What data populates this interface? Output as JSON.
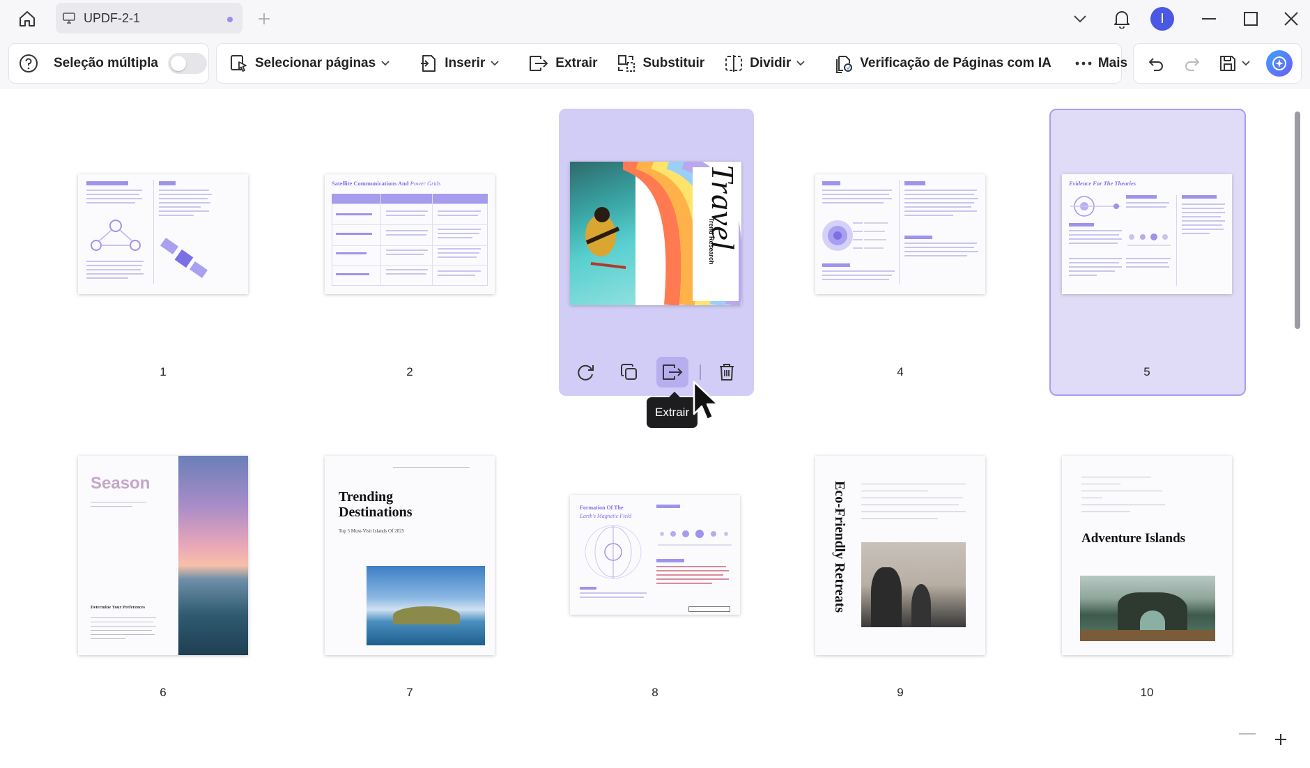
{
  "app": {
    "tab_title": "UPDF-2-1",
    "avatar_letter": "I"
  },
  "toolbar": {
    "multi_select_label": "Seleção múltipla",
    "multi_select_on": false,
    "select_pages_label": "Selecionar páginas",
    "insert_label": "Inserir",
    "extract_label": "Extrair",
    "replace_label": "Substituir",
    "split_label": "Dividir",
    "ai_check_label": "Verificação de Páginas com IA",
    "more_label": "Mais"
  },
  "pages": [
    {
      "number": "1",
      "header_text": ""
    },
    {
      "number": "2",
      "heading": "Satellite Communications And",
      "heading_italic": "Power Grids"
    },
    {
      "number": "3",
      "title": "Travel",
      "subtitle": "Trend Research"
    },
    {
      "number": "4"
    },
    {
      "number": "5",
      "heading": "Evidence For The Theories"
    },
    {
      "number": "6",
      "title": "Season",
      "section": "Determine Your Preferences"
    },
    {
      "number": "7",
      "title": "Trending Destinations",
      "subtitle": "Top 5 Must-Visit Islands Of 2025"
    },
    {
      "number": "8",
      "heading": "Formation Of The",
      "heading_italic": "Earth's Magnetic Field"
    },
    {
      "number": "9",
      "title": "Eco-Friendly Retreats"
    },
    {
      "number": "10",
      "title": "Adventure Islands"
    }
  ],
  "selection": {
    "hovered_page": "3",
    "selected_page": "5"
  },
  "tooltip": {
    "text": "Extrair"
  },
  "colors": {
    "accent": "#9e93ec",
    "selection_fill": "#cdc7f3",
    "avatar": "#4b58e6"
  }
}
